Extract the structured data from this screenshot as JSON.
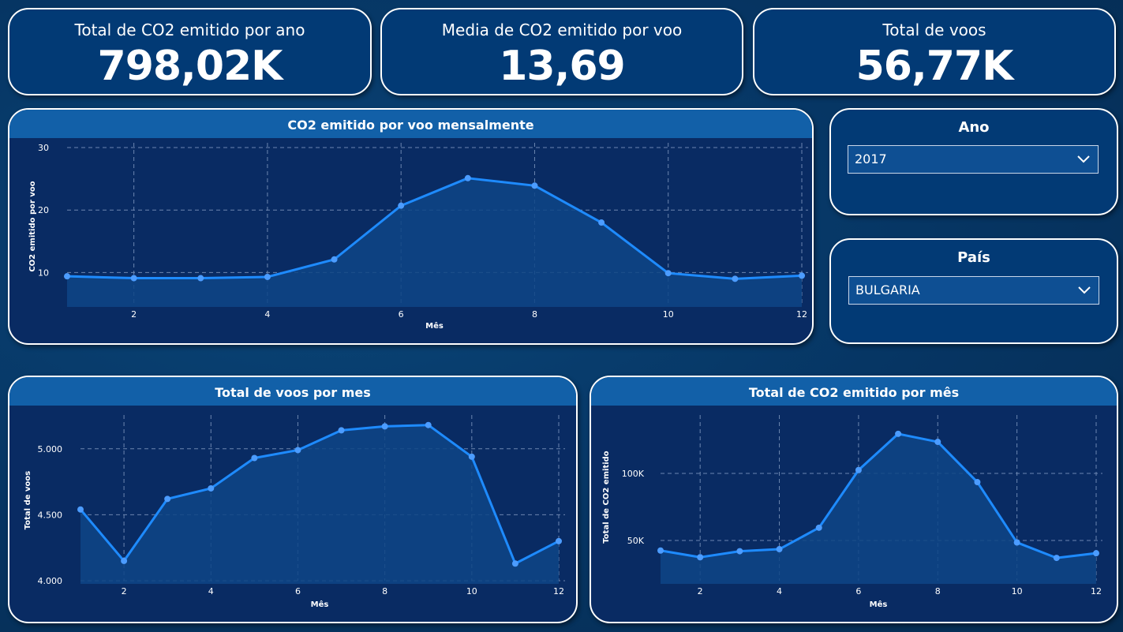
{
  "kpis": [
    {
      "title": "Total de CO2 emitido por ano",
      "value": "798,02K"
    },
    {
      "title": "Media de CO2 emitido por voo",
      "value": "13,69"
    },
    {
      "title": "Total de voos",
      "value": "56,77K"
    }
  ],
  "slicers": {
    "ano": {
      "title": "Ano",
      "selected": "2017",
      "icon": "chevron-down-icon"
    },
    "pais": {
      "title": "País",
      "selected": "BULGARIA",
      "icon": "chevron-down-icon"
    }
  },
  "colors": {
    "line": "#1e8bff",
    "area": "#0e4586",
    "grid": "#6c86b0",
    "header": "#1260a8"
  },
  "chart_data": [
    {
      "id": "co2-por-voo",
      "type": "area",
      "title": "CO2 emitido por voo mensalmente",
      "xlabel": "Mês",
      "ylabel": "CO2 emitido por voo",
      "x": [
        1,
        2,
        3,
        4,
        5,
        6,
        7,
        8,
        9,
        10,
        11,
        12
      ],
      "values": [
        9.4,
        9.1,
        9.1,
        9.3,
        12.1,
        20.7,
        25.1,
        23.9,
        18.0,
        9.9,
        9.0,
        9.5
      ],
      "xlim": [
        1,
        12
      ],
      "ylim": [
        5,
        30
      ],
      "xticks": [
        2,
        4,
        6,
        8,
        10,
        12
      ],
      "yticks": [
        {
          "v": 10,
          "label": "10"
        },
        {
          "v": 20,
          "label": "20"
        },
        {
          "v": 30,
          "label": "30"
        }
      ],
      "grid": true
    },
    {
      "id": "voos-por-mes",
      "type": "area",
      "title": "Total de voos por mes",
      "xlabel": "Mês",
      "ylabel": "Total de voos",
      "x": [
        1,
        2,
        3,
        4,
        5,
        6,
        7,
        8,
        9,
        10,
        11,
        12
      ],
      "values": [
        4540,
        4150,
        4620,
        4700,
        4930,
        4990,
        5140,
        5170,
        5180,
        4940,
        4130,
        4300
      ],
      "xlim": [
        1,
        12
      ],
      "ylim": [
        4000,
        5220
      ],
      "xticks": [
        2,
        4,
        6,
        8,
        10,
        12
      ],
      "yticks": [
        {
          "v": 4000,
          "label": "4.000"
        },
        {
          "v": 4500,
          "label": "4.500"
        },
        {
          "v": 5000,
          "label": "5.000"
        }
      ],
      "grid": true
    },
    {
      "id": "co2-por-mes",
      "type": "area",
      "title": "Total de CO2 emitido por mês",
      "xlabel": "Mês",
      "ylabel": "Total de CO2 emitido",
      "x": [
        1,
        2,
        3,
        4,
        5,
        6,
        7,
        8,
        9,
        10,
        11,
        12
      ],
      "values": [
        42500,
        37500,
        42000,
        43500,
        59500,
        102500,
        129500,
        123500,
        93500,
        48500,
        37000,
        40500
      ],
      "xlim": [
        1,
        12
      ],
      "ylim": [
        20000,
        140000
      ],
      "xticks": [
        2,
        4,
        6,
        8,
        10,
        12
      ],
      "yticks": [
        {
          "v": 50000,
          "label": "50K"
        },
        {
          "v": 100000,
          "label": "100K"
        }
      ],
      "grid": true
    }
  ]
}
